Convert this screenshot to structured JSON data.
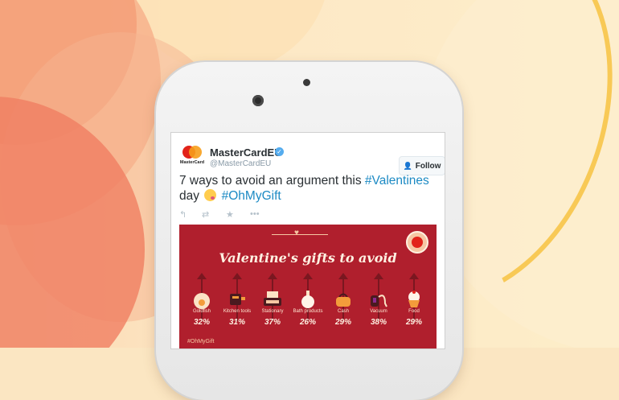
{
  "tweet": {
    "display_name": "MasterCardEU",
    "handle": "@MasterCardEU",
    "logo_text": "MasterCard",
    "follow_label": "Follow",
    "text_before": "7 ways to avoid an argument this ",
    "hashtag_1": "#Valentines",
    "text_mid": " day ",
    "hashtag_2": "#OhMyGift"
  },
  "infographic": {
    "title": "Valentine's gifts to avoid",
    "footer_tag": "#OhMyGift",
    "items": [
      {
        "label": "Goldfish",
        "value": "32%",
        "icon": "goldfish-bowl-icon"
      },
      {
        "label": "Kitchen tools",
        "value": "31%",
        "icon": "kitchen-tools-icon"
      },
      {
        "label": "Stationary",
        "value": "37%",
        "icon": "typewriter-icon"
      },
      {
        "label": "Bath products",
        "value": "26%",
        "icon": "bath-bottle-icon"
      },
      {
        "label": "Cash",
        "value": "29%",
        "icon": "purse-icon"
      },
      {
        "label": "Vacuum",
        "value": "38%",
        "icon": "vacuum-icon"
      },
      {
        "label": "Food",
        "value": "29%",
        "icon": "cupcake-icon"
      }
    ]
  },
  "colors": {
    "brand_red": "#e2231a",
    "brand_yellow": "#f79e1b",
    "twitter_blue": "#1c8ac4",
    "card_bg": "#b01f2d"
  }
}
